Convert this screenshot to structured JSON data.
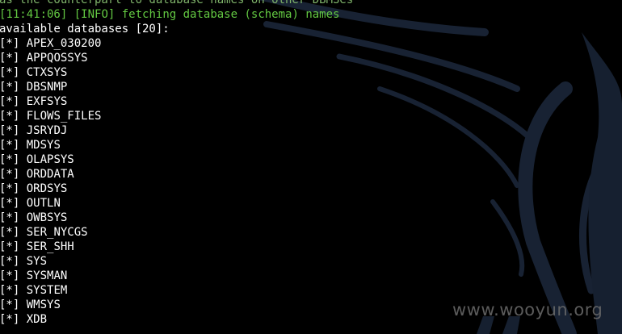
{
  "terminal": {
    "partial_line": "as the counterpart to database names on other DBMSes",
    "log": {
      "timestamp": "[11:41:06]",
      "level": "[INFO]",
      "message": "fetching database (schema) names"
    },
    "header": "available databases [20]:",
    "bullet": "[*]",
    "databases": [
      "APEX_030200",
      "APPQOSSYS",
      "CTXSYS",
      "DBSNMP",
      "EXFSYS",
      "FLOWS_FILES",
      "JSRYDJ",
      "MDSYS",
      "OLAPSYS",
      "ORDDATA",
      "ORDSYS",
      "OUTLN",
      "OWBSYS",
      "SER_NYCGS",
      "SER_SHH",
      "SYS",
      "SYSMAN",
      "SYSTEM",
      "WMSYS",
      "XDB"
    ]
  },
  "watermark": "www.wooyun.org",
  "colors": {
    "background": "#000000",
    "text": "#ffffff",
    "info": "#63c842",
    "dragon": "#1a2233"
  },
  "background_art": "kali-dragon-logo"
}
